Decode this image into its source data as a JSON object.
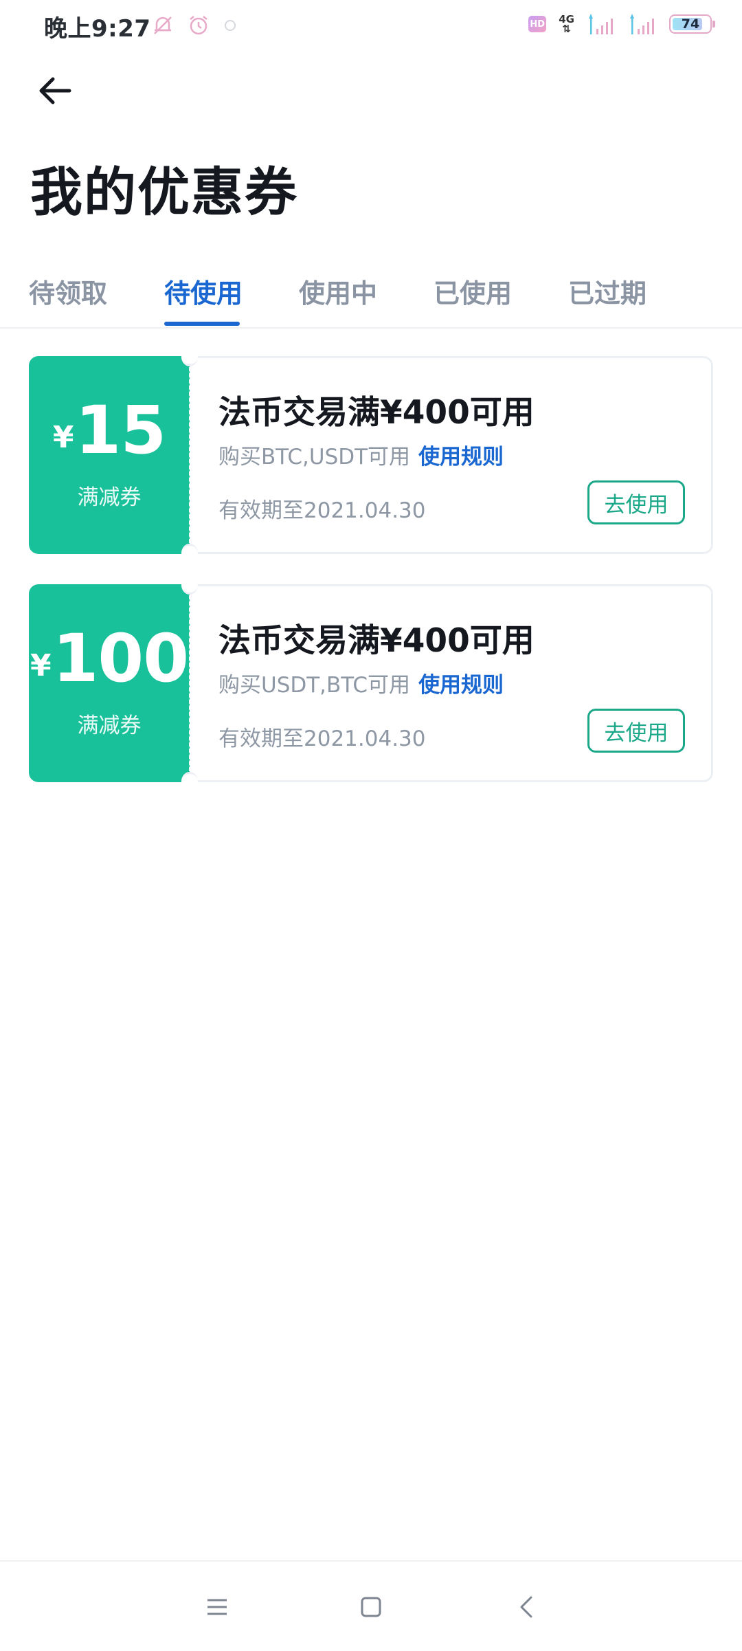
{
  "status_bar": {
    "time": "晚上9:27",
    "battery_level": "74",
    "network": "4G",
    "hd_label": "HD",
    "icons": [
      "mute-icon",
      "alarm-icon",
      "notification-icon",
      "signal-icon",
      "signal-icon",
      "battery-icon"
    ]
  },
  "header": {
    "back_icon": "arrow-left-icon",
    "title": "我的优惠券"
  },
  "tabs": [
    {
      "label": "待领取",
      "active": false
    },
    {
      "label": "待使用",
      "active": true
    },
    {
      "label": "使用中",
      "active": false
    },
    {
      "label": "已使用",
      "active": false
    },
    {
      "label": "已过期",
      "active": false
    }
  ],
  "coupons": [
    {
      "currency": "¥",
      "amount": "15",
      "type_label": "满减券",
      "title": "法币交易满¥400可用",
      "subtitle": "购买BTC,USDT可用",
      "rule_link": "使用规则",
      "expiry": "有效期至2021.04.30",
      "action_label": "去使用"
    },
    {
      "currency": "¥",
      "amount": "100",
      "type_label": "满减券",
      "title": "法币交易满¥400可用",
      "subtitle": "购买USDT,BTC可用",
      "rule_link": "使用规则",
      "expiry": "有效期至2021.04.30",
      "action_label": "去使用"
    }
  ],
  "colors": {
    "accent": "#1a67d2",
    "coupon_green": "#19c19a",
    "button_green": "#1aa889",
    "muted_text": "#8e97a4"
  },
  "nav_bar": {
    "icons": [
      "menu-icon",
      "home-icon",
      "back-icon"
    ]
  }
}
